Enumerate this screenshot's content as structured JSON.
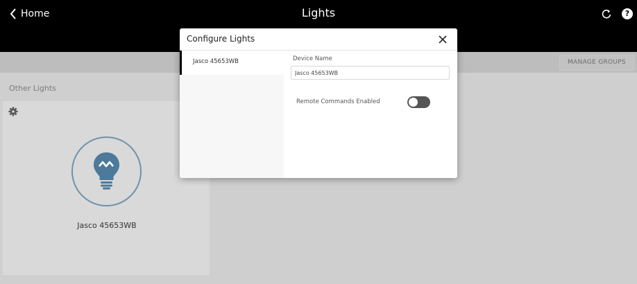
{
  "header": {
    "back_label": "Home",
    "title": "Lights"
  },
  "groups_bar": {
    "manage_groups_label": "MANAGE GROUPS"
  },
  "section": {
    "title": "Other Lights"
  },
  "device_card": {
    "name": "Jasco 45653WB",
    "icon_color": "#4d7a9b"
  },
  "modal": {
    "title": "Configure Lights",
    "sidebar_items": [
      {
        "label": "Jasco 45653WB",
        "selected": true
      }
    ],
    "device_name_label": "Device Name",
    "device_name_value": "Jasco 45653WB",
    "remote_commands_label": "Remote Commands Enabled",
    "remote_commands_enabled": false
  }
}
